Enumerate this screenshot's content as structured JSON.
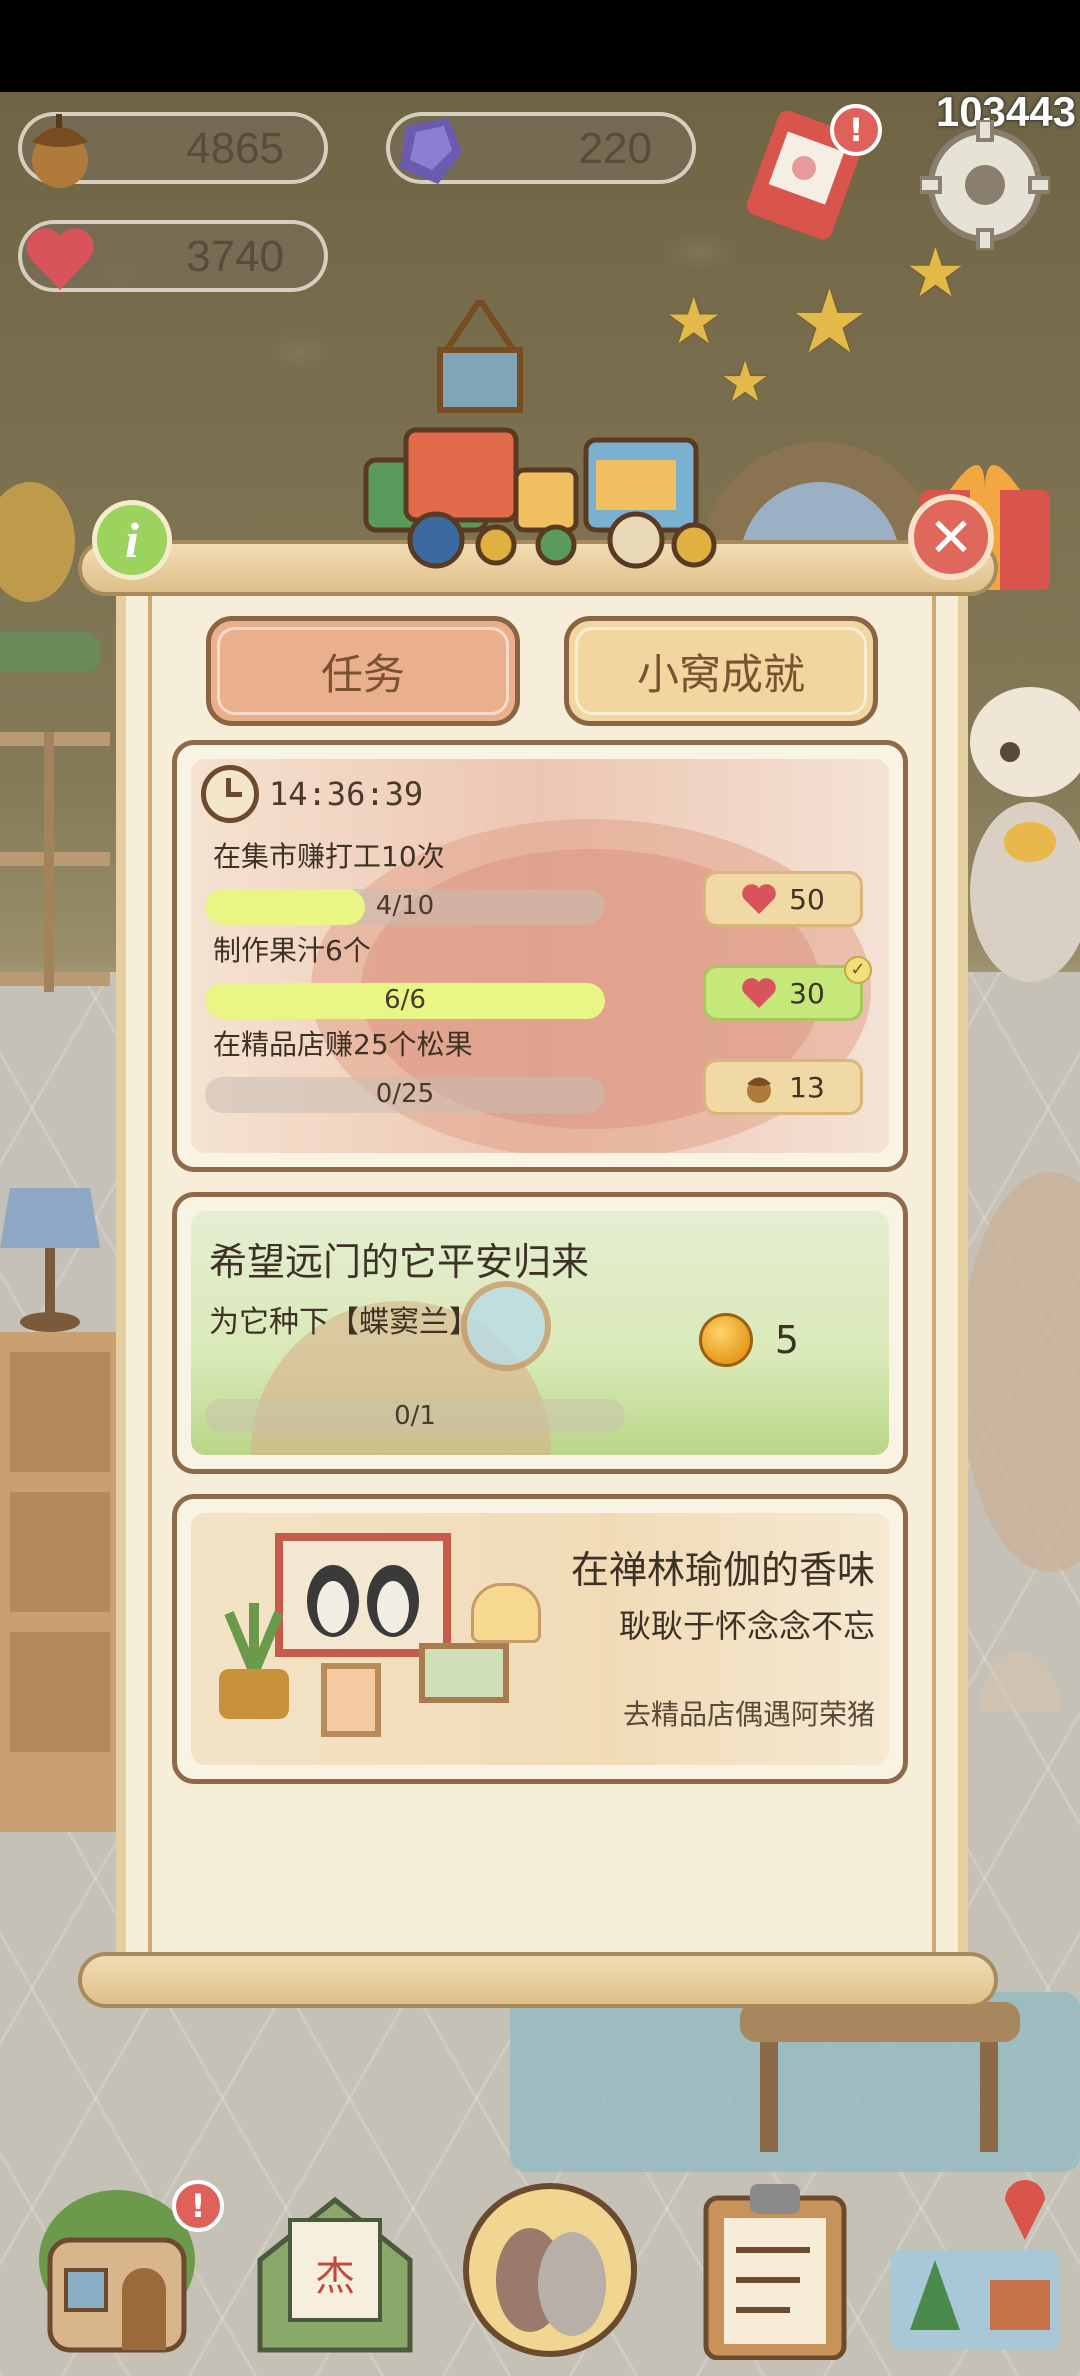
{
  "resources": {
    "acorns": "4865",
    "gems": "220",
    "hearts": "3740"
  },
  "player_id": "103443",
  "tabs": [
    {
      "label": "任务",
      "active": true
    },
    {
      "label": "小窝成就",
      "active": false
    }
  ],
  "daily": {
    "timer": "14:36:39",
    "tasks": [
      {
        "label": "在集市赚打工10次",
        "progress_text": "4/10",
        "progress": 0.4,
        "reward_icon": "heart-icon",
        "reward": "50",
        "done": false
      },
      {
        "label": "制作果汁6个",
        "progress_text": "6/6",
        "progress": 1.0,
        "reward_icon": "heart-icon",
        "reward": "30",
        "done": true
      },
      {
        "label": "在精品店赚25个松果",
        "progress_text": "0/25",
        "progress": 0.0,
        "reward_icon": "acorn-icon",
        "reward": "13",
        "done": false
      }
    ]
  },
  "story": {
    "title": "希望远门的它平安归来",
    "subtitle": "为它种下【蝶窦兰】",
    "progress_text": "0/1",
    "progress": 0.0,
    "reward": "5",
    "reward_icon": "bell-icon"
  },
  "memory": {
    "title": "在禅林瑜伽的香味",
    "subtitle": "耿耿于怀念念不忘",
    "hint": "去精品店偶遇阿荣猪"
  },
  "colors": {
    "accent_tab": "#eab08d",
    "panel": "#f6eed9",
    "progress_fill": "#e9f584",
    "alert": "#e0605a"
  },
  "nav": [
    "house-icon",
    "letter-icon",
    "paw-icon",
    "clipboard-icon",
    "map-icon"
  ]
}
